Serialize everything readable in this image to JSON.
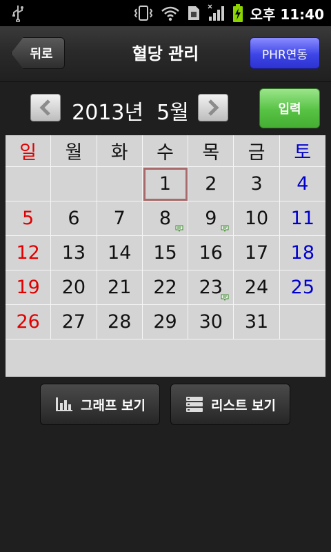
{
  "status_bar": {
    "time": "오후 11:40",
    "icons": [
      "usb-icon",
      "vibrate-icon",
      "wifi-icon",
      "sim-icon",
      "signal-icon",
      "battery-charging-icon"
    ]
  },
  "header": {
    "back_label": "뒤로",
    "title": "혈당 관리",
    "phr_label": "PHR연동"
  },
  "month_nav": {
    "label": "2013년  5월",
    "input_label": "입력"
  },
  "calendar": {
    "weekdays": [
      "일",
      "월",
      "화",
      "수",
      "목",
      "금",
      "토"
    ],
    "weeks": [
      [
        "",
        "",
        "",
        "1",
        "2",
        "3",
        "4"
      ],
      [
        "5",
        "6",
        "7",
        "8",
        "9",
        "10",
        "11"
      ],
      [
        "12",
        "13",
        "14",
        "15",
        "16",
        "17",
        "18"
      ],
      [
        "19",
        "20",
        "21",
        "22",
        "23",
        "24",
        "25"
      ],
      [
        "26",
        "27",
        "28",
        "29",
        "30",
        "31",
        ""
      ]
    ],
    "today": "1",
    "days_with_records": [
      "8",
      "9",
      "23"
    ]
  },
  "bottom": {
    "graph_label": "그래프 보기",
    "list_label": "리스트 보기"
  },
  "colors": {
    "sunday": "#e00000",
    "saturday": "#0000cc",
    "input_green": "#57c244",
    "phr_blue": "#3e45e6"
  }
}
